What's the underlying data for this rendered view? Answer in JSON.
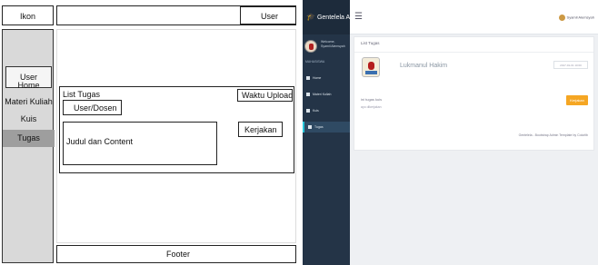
{
  "wireframe": {
    "logo": "Ikon",
    "user_header": "User",
    "sidebar": {
      "user": "User",
      "items": [
        "Home",
        "Materi Kuliah",
        "Kuis",
        "Tugas"
      ]
    },
    "content": {
      "list_label": "List Tugas",
      "lecturer_label": "User/Dosen",
      "upload_time_label": "Waktu Upload",
      "work_button": "Kerjakan",
      "title_content_label": "Judul dan Content"
    },
    "footer": "Footer"
  },
  "app": {
    "brand": "Gentelela Alela!",
    "welcome": "Welcome,",
    "sidebar_user": "Syamil Alemsyah",
    "role": "MAHASISWA",
    "nav": [
      "Home",
      "Materi Kuliah",
      "Kuis",
      "Tugas"
    ],
    "top_user": "Syamil Alemsyah",
    "panel_title": "List Tugas",
    "lecturer": "Lukmanul Hakim",
    "upload_time": "2017-01-01 10:00",
    "task_title": "ini tugas kuis",
    "task_content": "ayo dikerjakan",
    "do_button": "Kerjakan",
    "footer_credit": "Gentelela - Bootstrap Admin Template by Colorlib",
    "colors": {
      "sidebar": "#243447",
      "accent": "#26c6da",
      "button": "#f5a623"
    }
  }
}
